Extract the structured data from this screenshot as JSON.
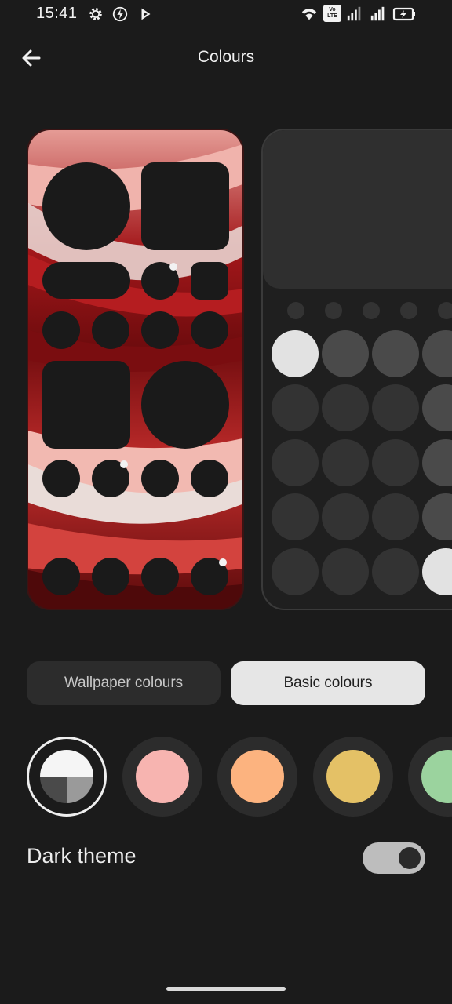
{
  "status_bar": {
    "time": "15:41",
    "left_icons": [
      "gear-icon",
      "bolt-icon",
      "play-store-icon"
    ],
    "right_icons": [
      "wifi-icon",
      "volte-icon",
      "signal-icon",
      "signal-icon",
      "battery-charging-icon"
    ],
    "volte_text_top": "Vo",
    "volte_text_bottom": "LTE"
  },
  "header": {
    "back_icon": "arrow-left-icon",
    "title": "Colours"
  },
  "tabs": [
    {
      "label": "Wallpaper colours",
      "selected": false
    },
    {
      "label": "Basic colours",
      "selected": true
    }
  ],
  "swatches": [
    {
      "name": "monochrome",
      "selected": true,
      "colors": [
        "#f5f5f5",
        "#4a4a4a",
        "#9a9a9a"
      ]
    },
    {
      "name": "pink",
      "selected": false,
      "color": "#f7b4b0"
    },
    {
      "name": "peach",
      "selected": false,
      "color": "#fcb37f"
    },
    {
      "name": "yellow",
      "selected": false,
      "color": "#e4c166"
    },
    {
      "name": "green",
      "selected": false,
      "color": "#9bd39e"
    }
  ],
  "dark_theme": {
    "label": "Dark theme",
    "enabled": true
  },
  "colors": {
    "background": "#1b1b1b",
    "accent_light": "#e6e6e6",
    "tab_inactive": "#2c2c2c"
  }
}
